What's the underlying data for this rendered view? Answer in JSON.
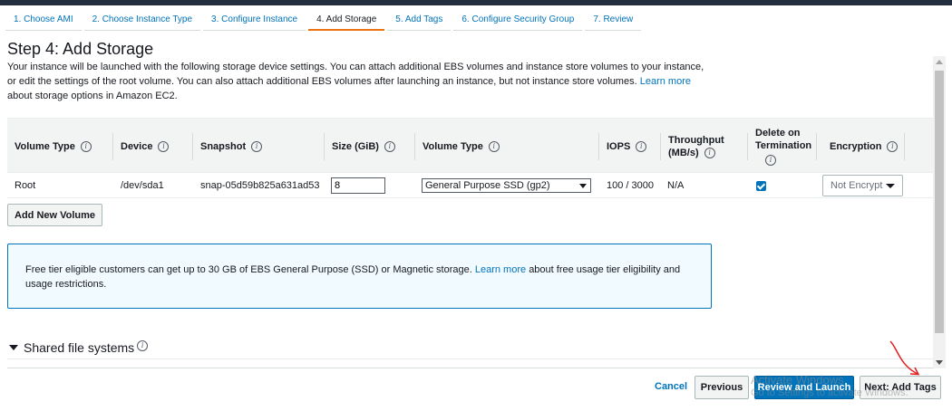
{
  "wizard": {
    "steps": [
      {
        "label": "1. Choose AMI"
      },
      {
        "label": "2. Choose Instance Type"
      },
      {
        "label": "3. Configure Instance"
      },
      {
        "label": "4. Add Storage"
      },
      {
        "label": "5. Add Tags"
      },
      {
        "label": "6. Configure Security Group"
      },
      {
        "label": "7. Review"
      }
    ],
    "active_step": 4
  },
  "page": {
    "title": "Step 4: Add Storage",
    "description_part1": "Your instance will be launched with the following storage device settings. You can attach additional EBS volumes and instance store volumes to your instance, or edit the settings of the root volume. You can also attach additional EBS volumes after launching an instance, but not instance store volumes.",
    "learn_more": "Learn more",
    "description_part2": "about storage options in Amazon EC2."
  },
  "table": {
    "headers": {
      "volume_type": "Volume Type",
      "device": "Device",
      "snapshot": "Snapshot",
      "size": "Size (GiB)",
      "volume_type2": "Volume Type",
      "iops": "IOPS",
      "throughput_line1": "Throughput",
      "throughput_line2": "(MB/s)",
      "delete_line1": "Delete on",
      "delete_line2": "Termination",
      "encryption": "Encryption"
    },
    "rows": [
      {
        "volume_type": "Root",
        "device": "/dev/sda1",
        "snapshot": "snap-05d59b825a631ad53",
        "size": "8",
        "ebs_type": "General Purpose SSD (gp2)",
        "iops": "100 / 3000",
        "throughput": "N/A",
        "delete_on_termination": true,
        "encryption": "Not Encrypt"
      }
    ]
  },
  "add_volume_label": "Add New Volume",
  "info_box": {
    "text1": "Free tier eligible customers can get up to 30 GB of EBS General Purpose (SSD) or Magnetic storage.",
    "link": "Learn more",
    "text2": "about free usage tier eligibility and usage restrictions."
  },
  "shared_fs_label": "Shared file systems",
  "footer": {
    "cancel": "Cancel",
    "previous": "Previous",
    "review_launch": "Review and Launch",
    "next": "Next: Add Tags"
  },
  "watermark": {
    "line1": "Activate Windows",
    "line2": "Go to Settings to activate Windows."
  },
  "colors": {
    "link": "#0073bb",
    "primary_button": "#0073bb",
    "active_tab_underline": "#ec7211",
    "annotation_arrow": "#e02020"
  }
}
